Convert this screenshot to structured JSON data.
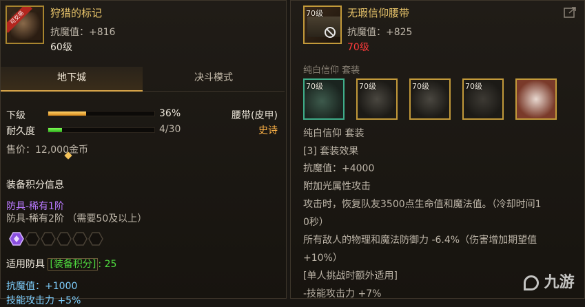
{
  "left": {
    "item": {
      "name": "狩猎的标记",
      "badge": "可交易",
      "stat": "抗魔值：+816",
      "level": "60级"
    },
    "tabs": [
      {
        "label": "地下城",
        "active": true
      },
      {
        "label": "决斗模式",
        "active": false
      }
    ],
    "grade": {
      "label": "下级",
      "value": "36%",
      "progress": 0.36
    },
    "durability": {
      "label": "耐久度",
      "value": "4/30",
      "progress": 0.13
    },
    "category": {
      "type": "腰带(皮甲)",
      "rarity": "史诗"
    },
    "price": "售价：12,000金币",
    "score_section": {
      "title": "装备积分信息",
      "tier_current": "防具-稀有1阶",
      "tier_next": "防具-稀有2阶 （需要50及以上）",
      "filled_slots": 1,
      "total_slots": 6,
      "apply_prefix": "适用防具",
      "apply_tag": "[装备积分]",
      "apply_colon": ":",
      "apply_value": "25",
      "bonus_stat": "抗魔值：+1000",
      "bonus_partial": "技能攻击力 +5%"
    }
  },
  "right": {
    "item": {
      "level": "70级",
      "name": "无瑕信仰腰带",
      "stat": "抗魔值：+825",
      "required_level": "70级"
    },
    "set_header_faded": "纯白信仰 套装",
    "set_pieces": [
      {
        "level": "70级"
      },
      {
        "level": "70级"
      },
      {
        "level": "70级"
      },
      {
        "level": "70级"
      },
      {
        "level": ""
      }
    ],
    "set_name": "纯白信仰 套装",
    "effect_title": "[3] 套装效果",
    "effect_lines": [
      "抗魔值：+4000",
      "附加光属性攻击",
      "攻击时，恢复队友3500点生命值和魔法值。（冷却时间1",
      "0秒）",
      "所有敌人的物理和魔法防御力 -6.4%（伤害增加期望值",
      "+10%）",
      "[单人挑战时额外适用]",
      "-技能攻击力 +7%"
    ]
  },
  "watermark": "九游",
  "colors": {
    "gold_border": "#b88a2d",
    "green": "#4fdc3f",
    "red": "#ff3b3b",
    "purple": "#b979ff"
  }
}
